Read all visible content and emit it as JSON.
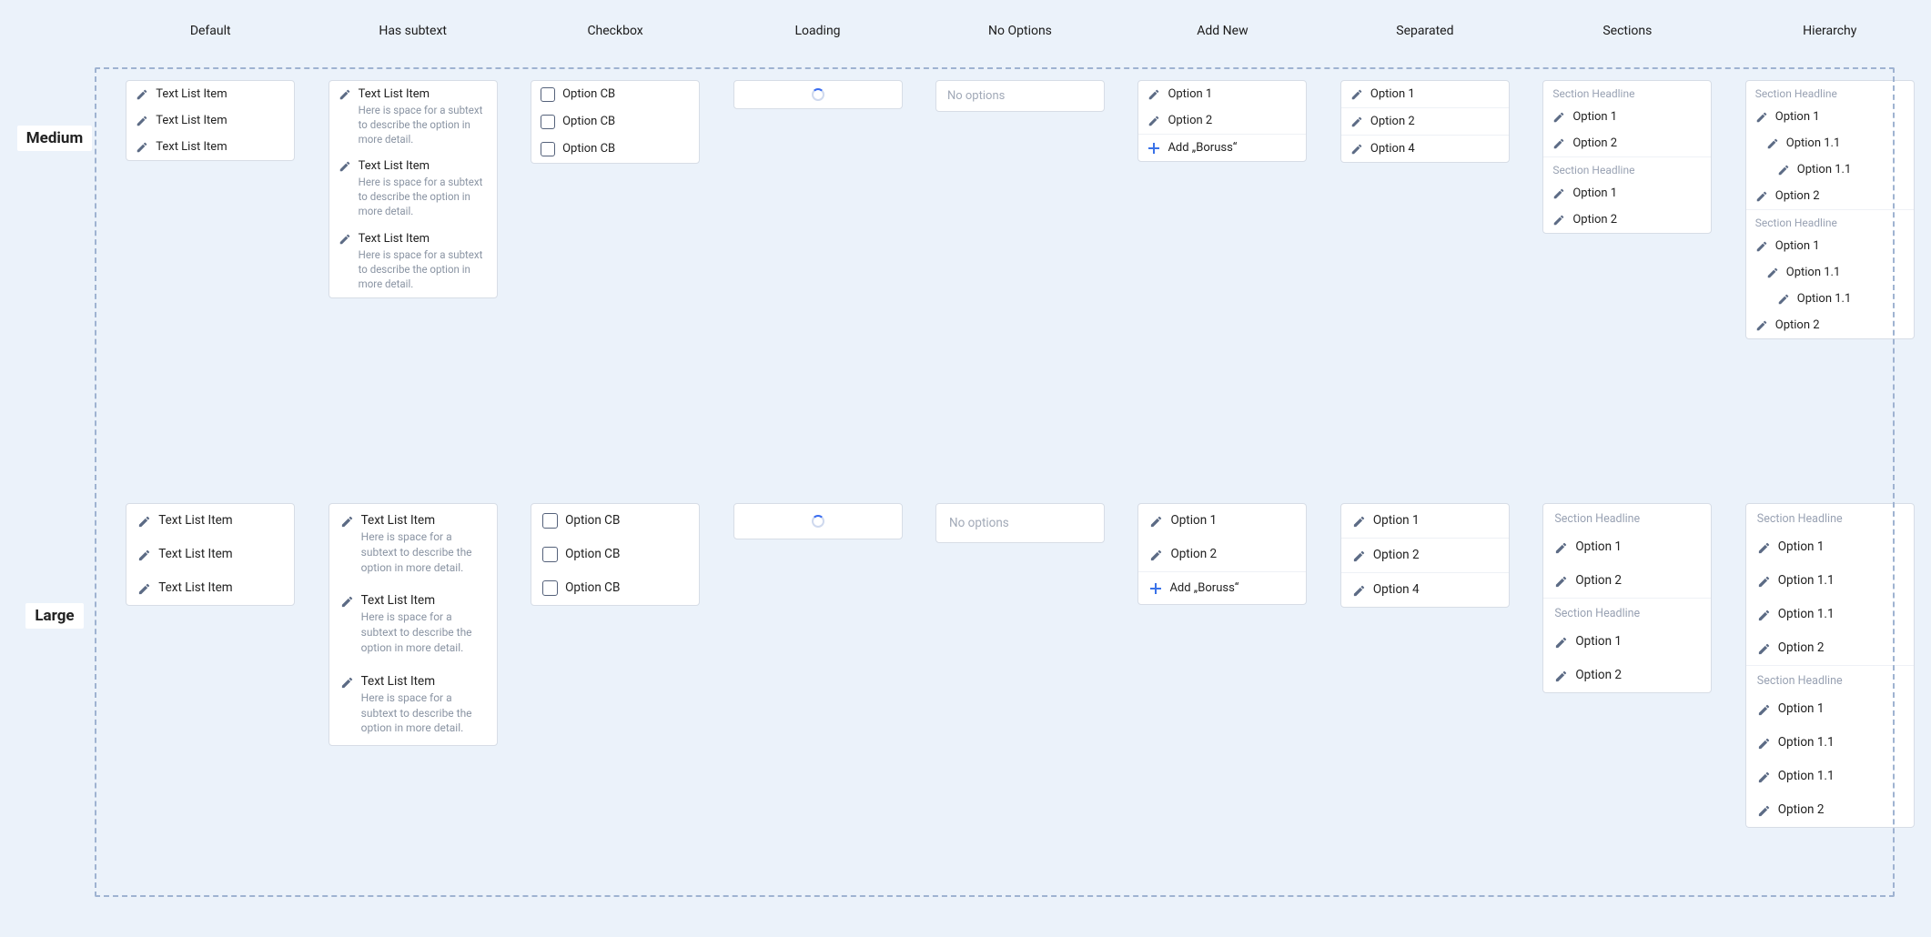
{
  "headers": {
    "default": "Default",
    "subtext": "Has subtext",
    "checkbox": "Checkbox",
    "loading": "Loading",
    "no_options": "No Options",
    "add_new": "Add New",
    "separated": "Separated",
    "sections": "Sections",
    "hierarchy": "Hierarchy"
  },
  "row_labels": {
    "medium": "Medium",
    "large": "Large"
  },
  "strings": {
    "text_list_item": "Text List Item",
    "subtext_m": "Here is space for a subtext to describe the option in more detail.",
    "subtext_l": "Here is space for a subtext to describe the option in more detail.",
    "option_cb": "Option CB",
    "no_options_text": "No options",
    "option_1": "Option 1",
    "option_2": "Option 2",
    "option_4": "Option 4",
    "option_1_1": "Option 1.1",
    "option_1_1_deep": "Option 1.1",
    "add_boruss": "Add „Boruss“",
    "section_headline": "Section Headline"
  }
}
